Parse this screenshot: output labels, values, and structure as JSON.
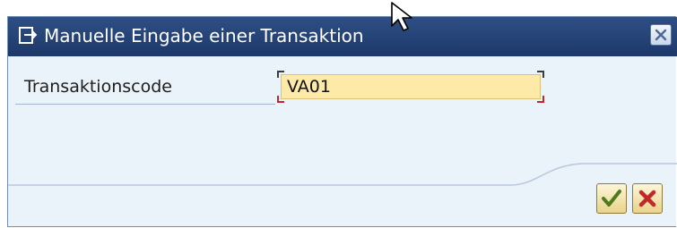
{
  "dialog": {
    "title": "Manuelle Eingabe einer Transaktion",
    "title_icon": "transaction-entry-icon",
    "close_icon": "close-icon"
  },
  "form": {
    "label": "Transaktionscode",
    "value": "VA01"
  },
  "buttons": {
    "confirm_icon": "checkmark-icon",
    "cancel_icon": "cancel-x-icon"
  },
  "colors": {
    "titlebar": "#1f3b6e",
    "body": "#eaf2fa",
    "input_bg": "#fde9a8",
    "cancel_red": "#c0282a"
  }
}
